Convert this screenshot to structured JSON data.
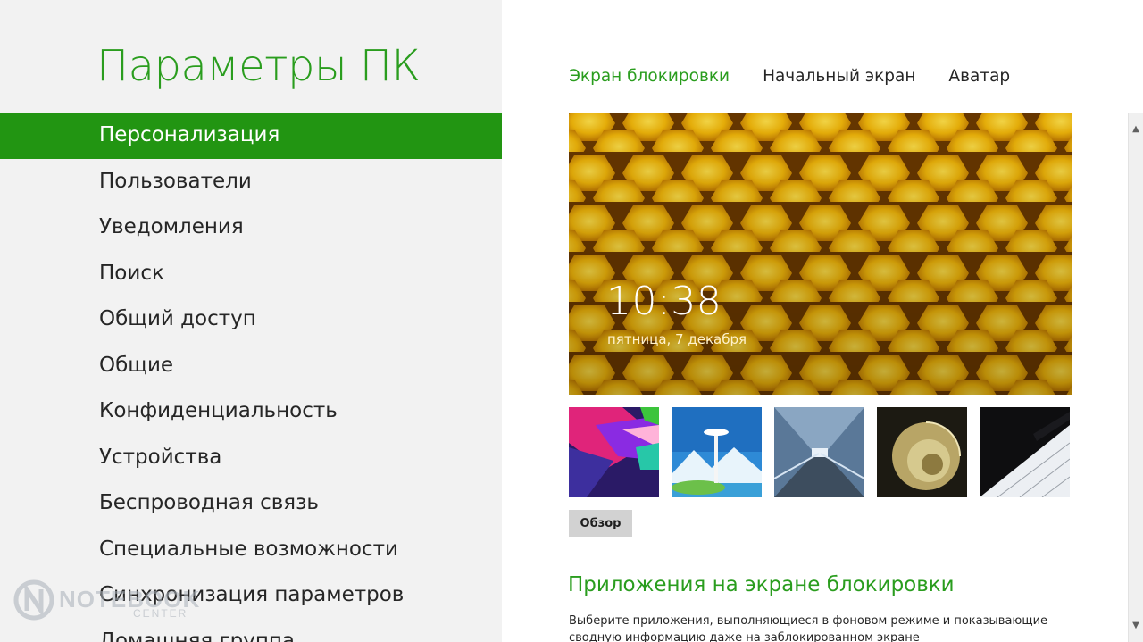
{
  "app": {
    "title": "Параметры ПК"
  },
  "nav": {
    "items": [
      {
        "label": "Персонализация",
        "active": true
      },
      {
        "label": "Пользователи"
      },
      {
        "label": "Уведомления"
      },
      {
        "label": "Поиск"
      },
      {
        "label": "Общий доступ"
      },
      {
        "label": "Общие"
      },
      {
        "label": "Конфиденциальность"
      },
      {
        "label": "Устройства"
      },
      {
        "label": "Беспроводная связь"
      },
      {
        "label": "Специальные возможности"
      },
      {
        "label": "Синхронизация параметров"
      },
      {
        "label": "Домашняя группа"
      }
    ]
  },
  "tabs": [
    {
      "label": "Экран блокировки",
      "active": true
    },
    {
      "label": "Начальный экран"
    },
    {
      "label": "Аватар"
    }
  ],
  "lockscreen": {
    "time": "10:38",
    "date": "пятница, 7 декабря"
  },
  "thumbnails": [
    {
      "name": "abstract-colors"
    },
    {
      "name": "space-needle"
    },
    {
      "name": "light-tunnel"
    },
    {
      "name": "nautilus-shell"
    },
    {
      "name": "piano-keys"
    }
  ],
  "browse": {
    "label": "Обзор"
  },
  "apps_section": {
    "title": "Приложения на экране блокировки",
    "description": "Выберите приложения, выполняющиеся в фоновом режиме и показывающие сводную информацию даже на заблокированном экране"
  },
  "watermark": {
    "line1": "NOTEBOOK",
    "line2": "CENTER"
  },
  "colors": {
    "accent": "#229512",
    "accent_text": "#2a9d1e",
    "left_bg": "#f2f2f2"
  }
}
